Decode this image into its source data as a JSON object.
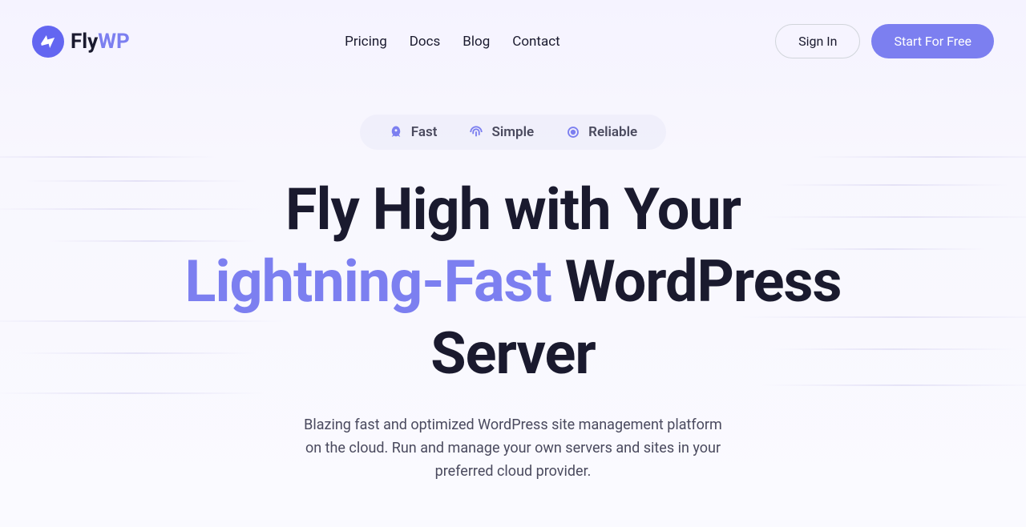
{
  "logo": {
    "text_main": "Fly",
    "text_accent": "WP"
  },
  "nav": {
    "pricing": "Pricing",
    "docs": "Docs",
    "blog": "Blog",
    "contact": "Contact"
  },
  "actions": {
    "signin": "Sign In",
    "start": "Start For Free"
  },
  "badges": {
    "fast": "Fast",
    "simple": "Simple",
    "reliable": "Reliable"
  },
  "hero": {
    "title_line1": "Fly High with Your",
    "title_accent": "Lightning-Fast",
    "title_rest": " WordPress Server",
    "subtitle": "Blazing fast and optimized WordPress site management platform on the cloud. Run and manage your own servers and sites in your preferred cloud provider."
  }
}
